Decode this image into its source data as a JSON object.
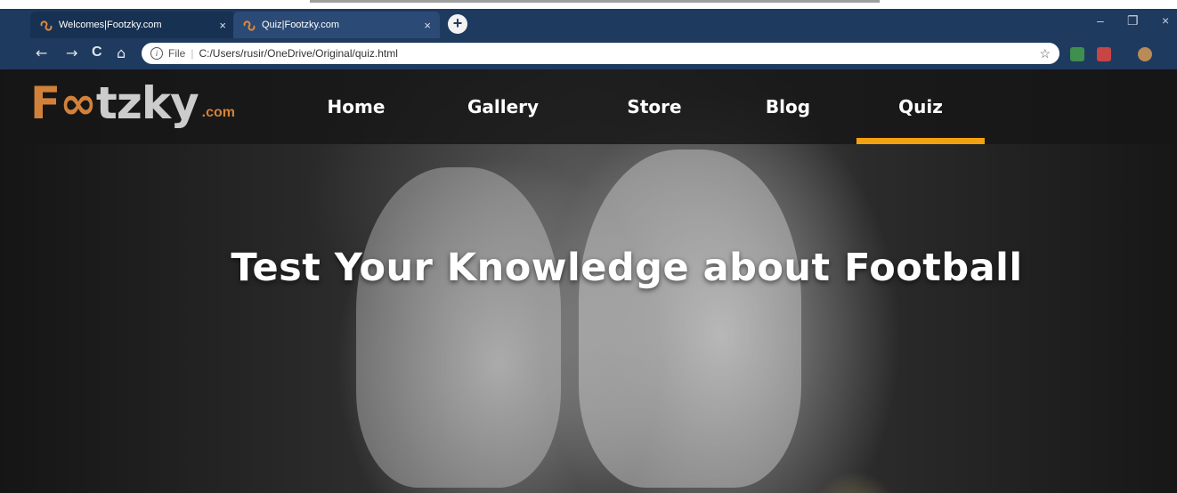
{
  "browser": {
    "tabs": [
      {
        "title": "Welcomes|Footzky.com",
        "close": "×"
      },
      {
        "title": "Quiz|Footzky.com",
        "close": "×"
      }
    ],
    "new_tab": "+",
    "window_controls": {
      "minimize": "–",
      "restore": "❐",
      "close": "×"
    },
    "nav": {
      "back": "←",
      "forward": "→",
      "reload": "C",
      "home": "⌂"
    },
    "address": {
      "info": "i",
      "scheme": "File",
      "sep": "|",
      "url": "C:/Users/rusir/OneDrive/Original/quiz.html",
      "bookmark": "☆"
    },
    "extensions": [
      "drive-extension-icon",
      "pdf-extension-icon",
      "profile-avatar-icon"
    ]
  },
  "site": {
    "logo": {
      "f": "F",
      "oo": "∞",
      "rest": "tzky",
      "com": ".com"
    },
    "menu": [
      {
        "label": "Home",
        "active": false
      },
      {
        "label": "Gallery",
        "active": false
      },
      {
        "label": "Store",
        "active": false
      },
      {
        "label": "Blog",
        "active": false
      },
      {
        "label": "Quiz",
        "active": true
      }
    ],
    "accent_color": "#f2a20f",
    "hero_title": "Test Your Knowledge about Football"
  }
}
